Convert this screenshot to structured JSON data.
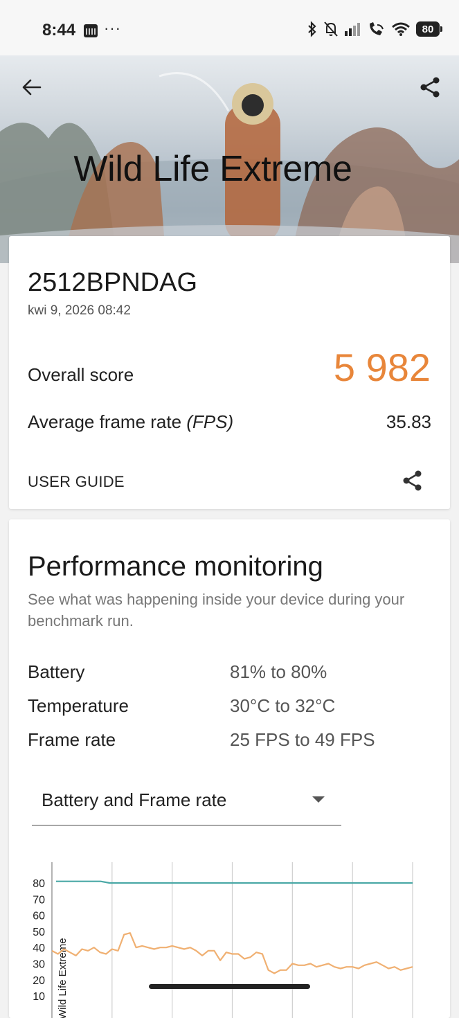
{
  "status_bar": {
    "time": "8:44",
    "more": "···",
    "battery": "80",
    "icons": [
      "calendar-icon",
      "bluetooth-icon",
      "bell-off-icon",
      "signal-icon",
      "wifi-call-icon",
      "wifi-icon",
      "battery-icon"
    ]
  },
  "header": {
    "title": "Wild Life Extreme",
    "back_icon": "arrow-left-icon",
    "share_icon": "share-icon"
  },
  "result": {
    "device": "2512BPNDAG",
    "date": "kwi 9, 2026 08:42",
    "overall_label": "Overall score",
    "overall_value": "5 982",
    "fps_label": "Average frame rate",
    "fps_unit": "(FPS)",
    "fps_value": "35.83",
    "guide": "USER GUIDE"
  },
  "performance": {
    "title": "Performance monitoring",
    "description": "See what was happening inside your device during your benchmark run.",
    "rows": [
      {
        "label": "Battery",
        "value": "81% to 80%"
      },
      {
        "label": "Temperature",
        "value": "30°C to 32°C"
      },
      {
        "label": "Frame rate",
        "value": "25 FPS to 49 FPS"
      }
    ],
    "select_value": "Battery and Frame rate"
  },
  "chart_data": {
    "type": "line",
    "yticks": [
      "80",
      "70",
      "60",
      "50",
      "40",
      "30",
      "20",
      "10"
    ],
    "ylim": [
      10,
      85
    ],
    "annotation": "Wild Life Extreme",
    "accent_battery": "#4aa8a6",
    "accent_fps": "#f0b072",
    "series": [
      {
        "values": [
          81,
          81,
          81,
          81,
          81,
          81,
          80,
          80,
          80,
          80,
          80,
          80,
          80,
          80,
          80,
          80,
          80,
          80,
          80,
          80,
          80,
          80,
          80,
          80,
          80,
          80,
          80,
          80,
          80,
          80,
          80,
          80,
          80,
          80,
          80,
          80,
          80,
          80,
          80,
          80,
          80
        ]
      },
      {
        "values": [
          38,
          36,
          39,
          37,
          35,
          39,
          38,
          40,
          37,
          36,
          39,
          38,
          48,
          49,
          40,
          41,
          40,
          39,
          40,
          40,
          41,
          40,
          39,
          40,
          38,
          35,
          38,
          38,
          32,
          37,
          36,
          36,
          33,
          34,
          37,
          36,
          26,
          24,
          26,
          26,
          30,
          29,
          29,
          30,
          28,
          29,
          30,
          28,
          27,
          28,
          28,
          27,
          29,
          30,
          31,
          29,
          27,
          28,
          26,
          27,
          28
        ]
      }
    ]
  }
}
